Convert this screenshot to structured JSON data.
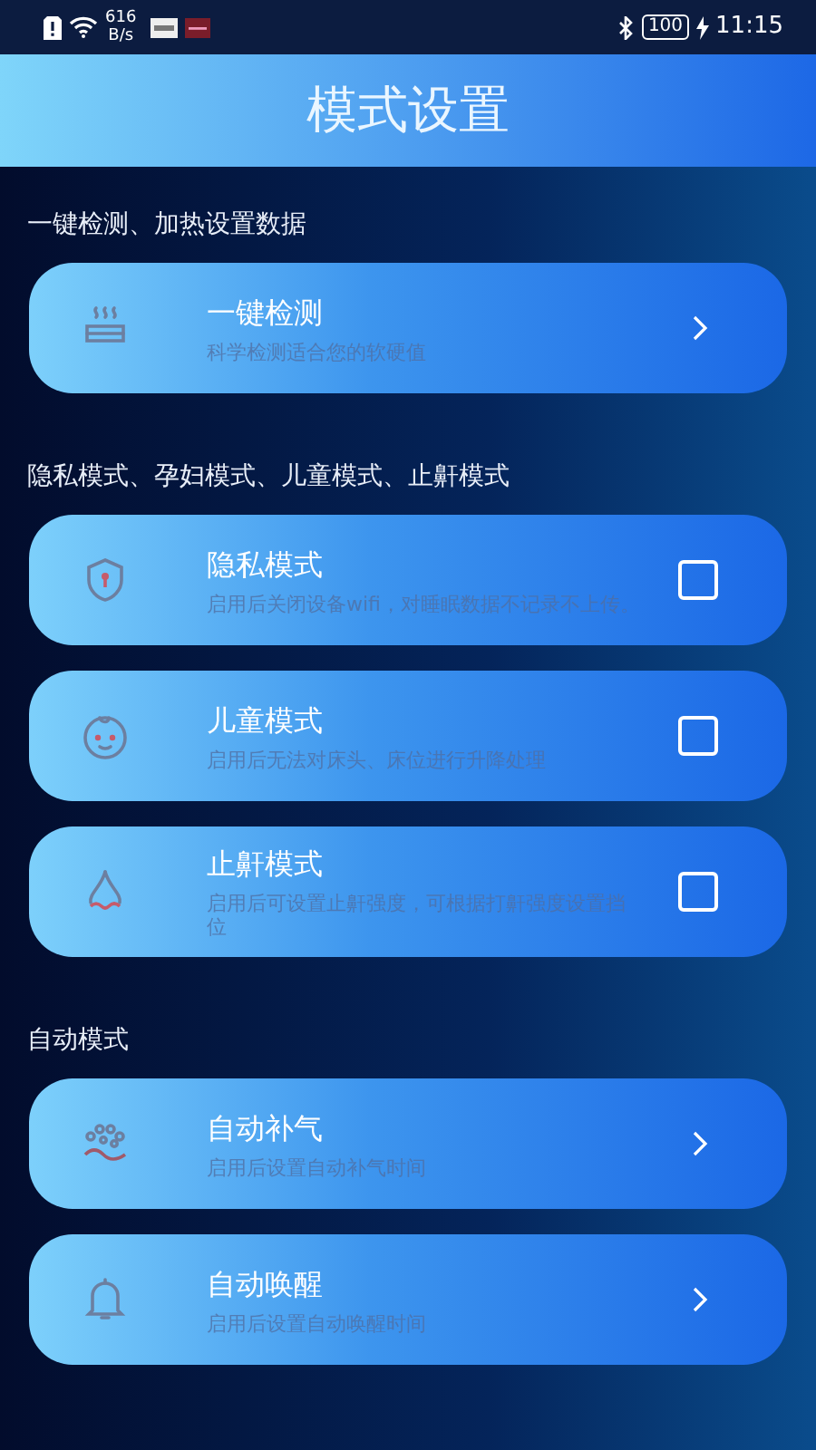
{
  "status_bar": {
    "net_speed_value": "616",
    "net_speed_unit": "B/s",
    "battery": "100",
    "time": "11:15"
  },
  "header": {
    "title": "模式设置"
  },
  "sections": [
    {
      "label": "一键检测、加热设置数据",
      "items": [
        {
          "kind": "link",
          "title": "一键检测",
          "subtitle": "科学检测适合您的软硬值"
        }
      ]
    },
    {
      "label": "隐私模式、孕妇模式、儿童模式、止鼾模式",
      "items": [
        {
          "kind": "checkbox",
          "title": "隐私模式",
          "subtitle": "启用后关闭设备wifi，对睡眠数据不记录不上传。",
          "checked": false
        },
        {
          "kind": "checkbox",
          "title": "儿童模式",
          "subtitle": "启用后无法对床头、床位进行升降处理",
          "checked": false
        },
        {
          "kind": "checkbox",
          "title": "止鼾模式",
          "subtitle": "启用后可设置止鼾强度，可根据打鼾强度设置挡位",
          "checked": false
        }
      ]
    },
    {
      "label": "自动模式",
      "items": [
        {
          "kind": "link",
          "title": "自动补气",
          "subtitle": "启用后设置自动补气时间"
        },
        {
          "kind": "link",
          "title": "自动唤醒",
          "subtitle": "启用后设置自动唤醒时间"
        }
      ]
    }
  ]
}
